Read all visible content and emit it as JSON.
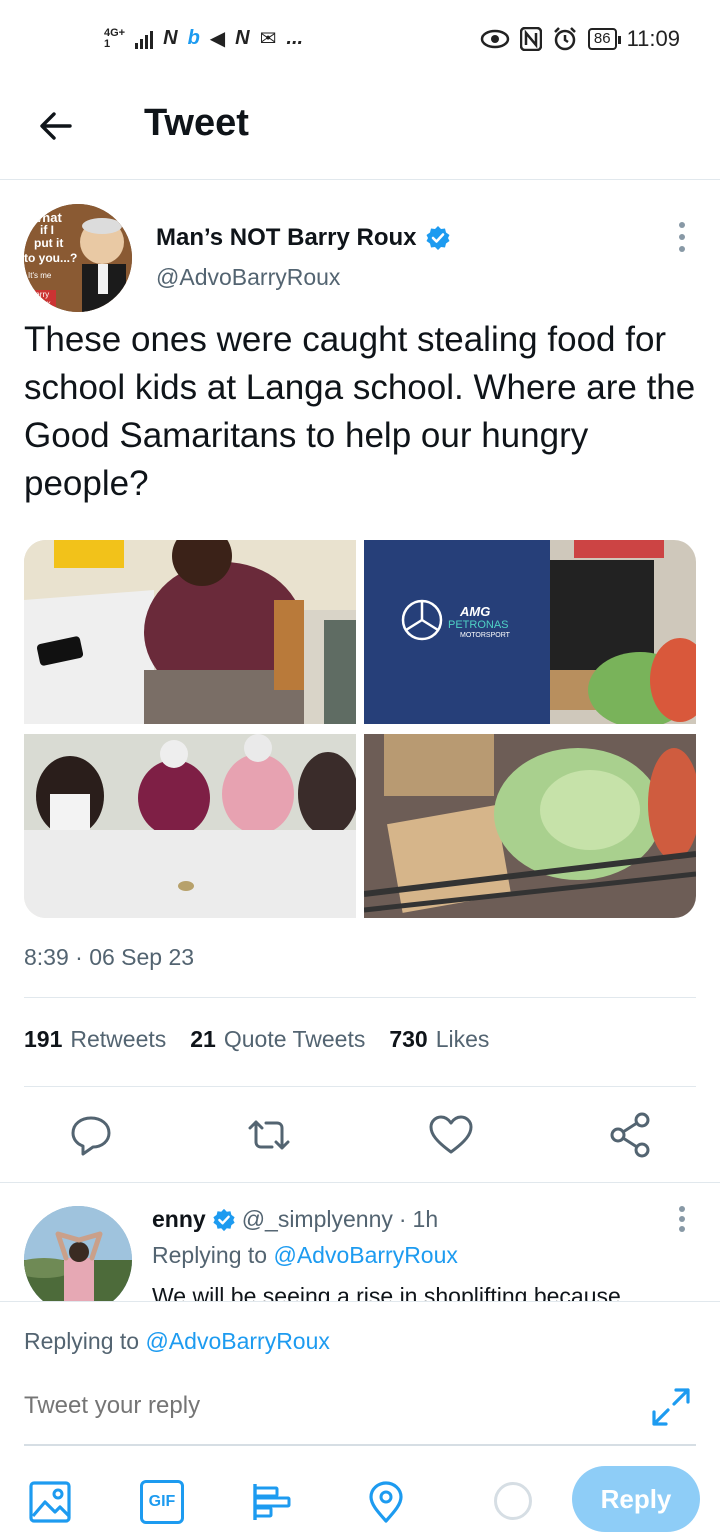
{
  "status_bar": {
    "network": "4G+",
    "signal_sub": "1",
    "notification_glyphs": [
      "N",
      "b",
      "◀",
      "N",
      "✉",
      "..."
    ],
    "battery": "86",
    "time": "11:09"
  },
  "header": {
    "title": "Tweet"
  },
  "tweet": {
    "author_name": "Man’s NOT Barry Roux",
    "author_handle": "@AdvoBarryRoux",
    "avatar_caption_lines": [
      "What",
      "if I",
      "put it",
      "to you...?",
      "It's me",
      "Barry",
      "Roux"
    ],
    "text": "These ones were caught stealing food for school kids at Langa school. Where are the Good Samaritans to help our hungry people?",
    "timestamp": "8:39 · 06 Sep 23",
    "retweets_count": "191",
    "retweets_label": "Retweets",
    "quote_count": "21",
    "quote_label": "Quote Tweets",
    "likes_count": "730",
    "likes_label": "Likes",
    "photo_text": {
      "shirt_brand": "AMG",
      "shirt_sponsor": "PETRONAS",
      "shirt_team": "MOTORSPORT"
    }
  },
  "reply_preview": {
    "name": "enny",
    "handle": "@_simplyenny",
    "separator": "·",
    "age": "1h",
    "replying_prefix": "Replying to",
    "replying_handle": "@AdvoBarryRoux",
    "snippet": "We will be seeing a rise in shoplifting because"
  },
  "compose": {
    "replying_prefix": "Replying to",
    "replying_handle": "@AdvoBarryRoux",
    "placeholder": "Tweet your reply",
    "gif_label": "GIF",
    "reply_button": "Reply"
  },
  "colors": {
    "accent": "#1d9bf0",
    "reply_button_disabled": "#8ecdf7",
    "secondary_text": "#536471",
    "icon_gray": "#536471"
  },
  "icons": {
    "back": "arrow-left-icon",
    "verified": "verified-badge-icon",
    "more": "more-vertical-icon",
    "reply": "comment-icon",
    "retweet": "retweet-icon",
    "like": "heart-icon",
    "share": "share-icon",
    "expand": "expand-icon",
    "image": "image-icon",
    "gif": "gif-icon",
    "poll": "poll-icon",
    "location": "location-icon"
  }
}
